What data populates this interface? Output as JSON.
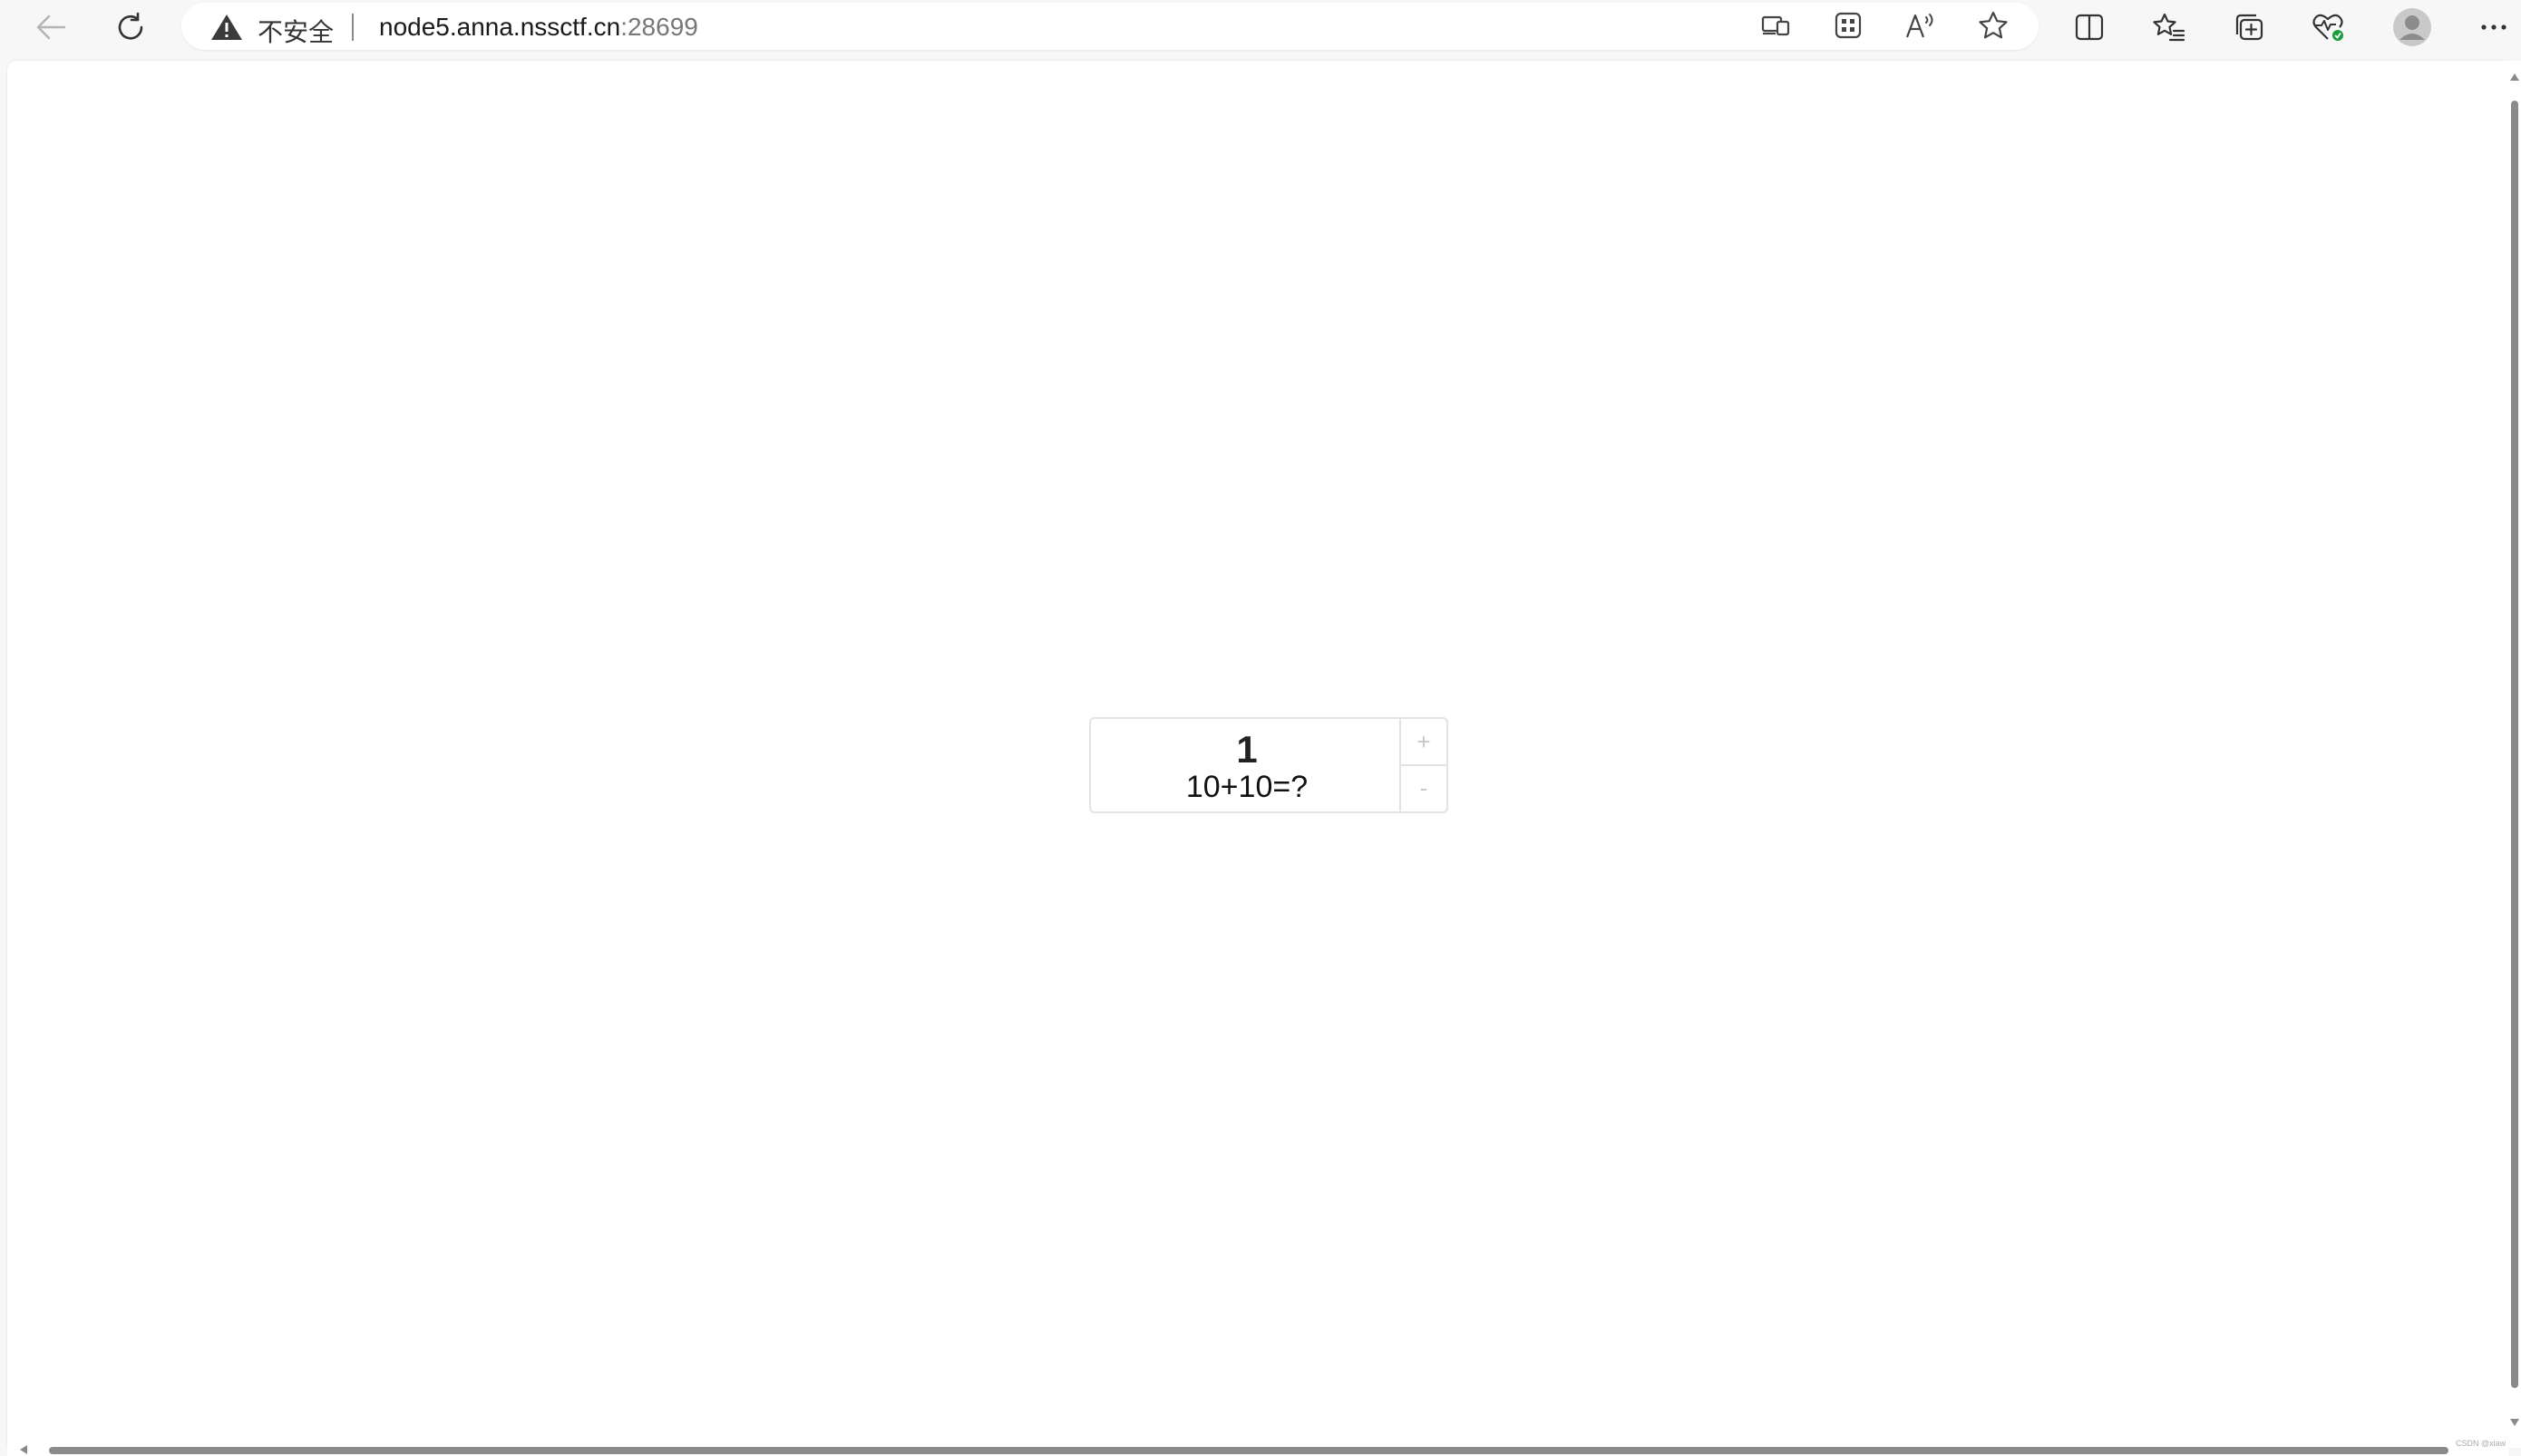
{
  "browser": {
    "security_label": "不安全",
    "url_host": "node5.anna.nssctf.cn",
    "url_port": ":28699",
    "icons": {
      "back": "back-arrow-icon",
      "refresh": "refresh-icon",
      "warning": "warning-triangle-icon",
      "cast": "cast-device-icon",
      "apps": "apps-grid-icon",
      "read_aloud": "read-aloud-icon",
      "favorite": "star-icon",
      "split_screen": "split-screen-icon",
      "favorites": "favorites-list-icon",
      "collections": "collections-icon",
      "performance": "heart-pulse-icon",
      "profile": "profile-avatar-icon",
      "more": "more-dots-icon"
    }
  },
  "page": {
    "widget": {
      "value": "1",
      "question": "10+10=?",
      "increment_label": "+",
      "decrement_label": "-"
    }
  },
  "watermark": "CSDN @xiaw"
}
